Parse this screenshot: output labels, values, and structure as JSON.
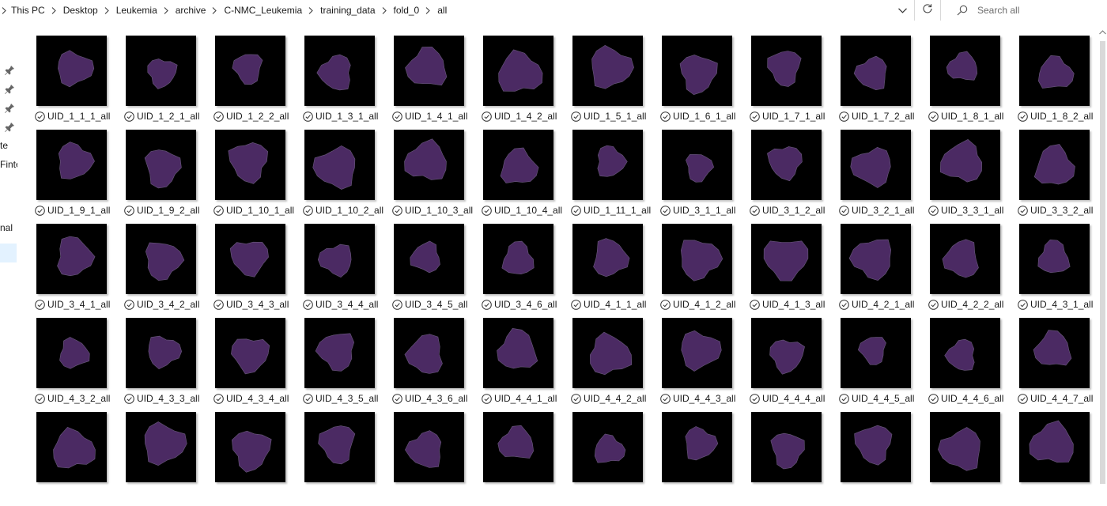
{
  "breadcrumb": {
    "items": [
      "This PC",
      "Desktop",
      "Leukemia",
      "archive",
      "C-NMC_Leukemia",
      "training_data",
      "fold_0",
      "all"
    ]
  },
  "search": {
    "placeholder": "Search all"
  },
  "nav_labels": [
    "te",
    "Finte",
    "nal"
  ],
  "accent_color": "#cce8ff",
  "cell_color": "#4b2a63",
  "files": [
    "UID_1_1_1_all",
    "UID_1_2_1_all",
    "UID_1_2_2_all",
    "UID_1_3_1_all",
    "UID_1_4_1_all",
    "UID_1_4_2_all",
    "UID_1_5_1_all",
    "UID_1_6_1_all",
    "UID_1_7_1_all",
    "UID_1_7_2_all",
    "UID_1_8_1_all",
    "UID_1_8_2_all",
    "UID_1_9_1_all",
    "UID_1_9_2_all",
    "UID_1_10_1_all",
    "UID_1_10_2_all",
    "UID_1_10_3_all",
    "UID_1_10_4_all",
    "UID_1_11_1_all",
    "UID_3_1_1_all",
    "UID_3_1_2_all",
    "UID_3_2_1_all",
    "UID_3_3_1_all",
    "UID_3_3_2_all",
    "UID_3_4_1_all",
    "UID_3_4_2_all",
    "UID_3_4_3_all",
    "UID_3_4_4_all",
    "UID_3_4_5_all",
    "UID_3_4_6_all",
    "UID_4_1_1_all",
    "UID_4_1_2_all",
    "UID_4_1_3_all",
    "UID_4_2_1_all",
    "UID_4_2_2_all",
    "UID_4_3_1_all",
    "UID_4_3_2_all",
    "UID_4_3_3_all",
    "UID_4_3_4_all",
    "UID_4_3_5_all",
    "UID_4_3_6_all",
    "UID_4_4_1_all",
    "UID_4_4_2_all",
    "UID_4_4_3_all",
    "UID_4_4_4_all",
    "UID_4_4_5_all",
    "UID_4_4_6_all",
    "UID_4_4_7_all",
    "",
    "",
    "",
    "",
    "",
    "",
    "",
    "",
    "",
    "",
    "",
    ""
  ]
}
